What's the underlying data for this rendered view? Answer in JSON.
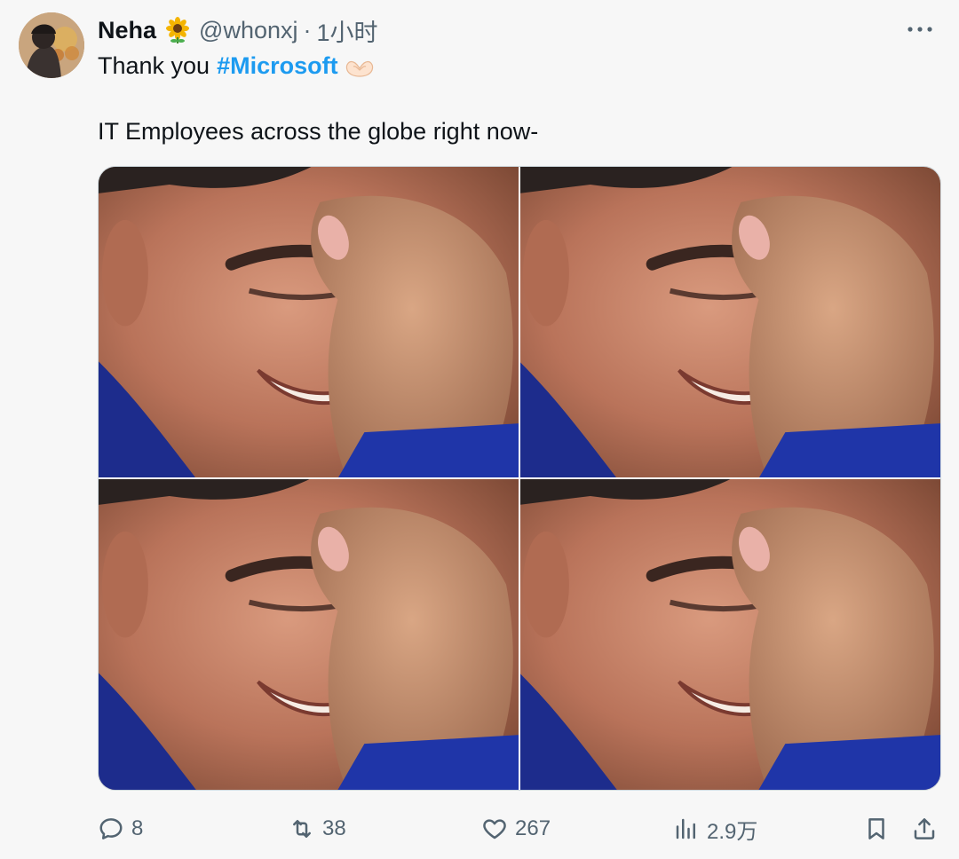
{
  "author": {
    "display_name": "Neha",
    "handle": "@whonxj",
    "separator": "·",
    "time": "1小时",
    "name_emoji": "sunflower-icon"
  },
  "tweet": {
    "line1_text": "Thank you",
    "hashtag": "#Microsoft",
    "line1_emoji": "heart-hands-icon",
    "line2_text": "IT Employees across the globe right now-"
  },
  "media": {
    "layout": "2x2 grid",
    "alt": "four-panel meme of a man crying while pinching the bridge of his nose"
  },
  "actions": {
    "replies": "8",
    "retweets": "38",
    "likes": "267",
    "views": "2.9万"
  },
  "colors": {
    "hashtag": "#1d9bf0",
    "secondary_text": "#536471",
    "primary_text": "#0f1419",
    "background": "#f7f7f7"
  }
}
